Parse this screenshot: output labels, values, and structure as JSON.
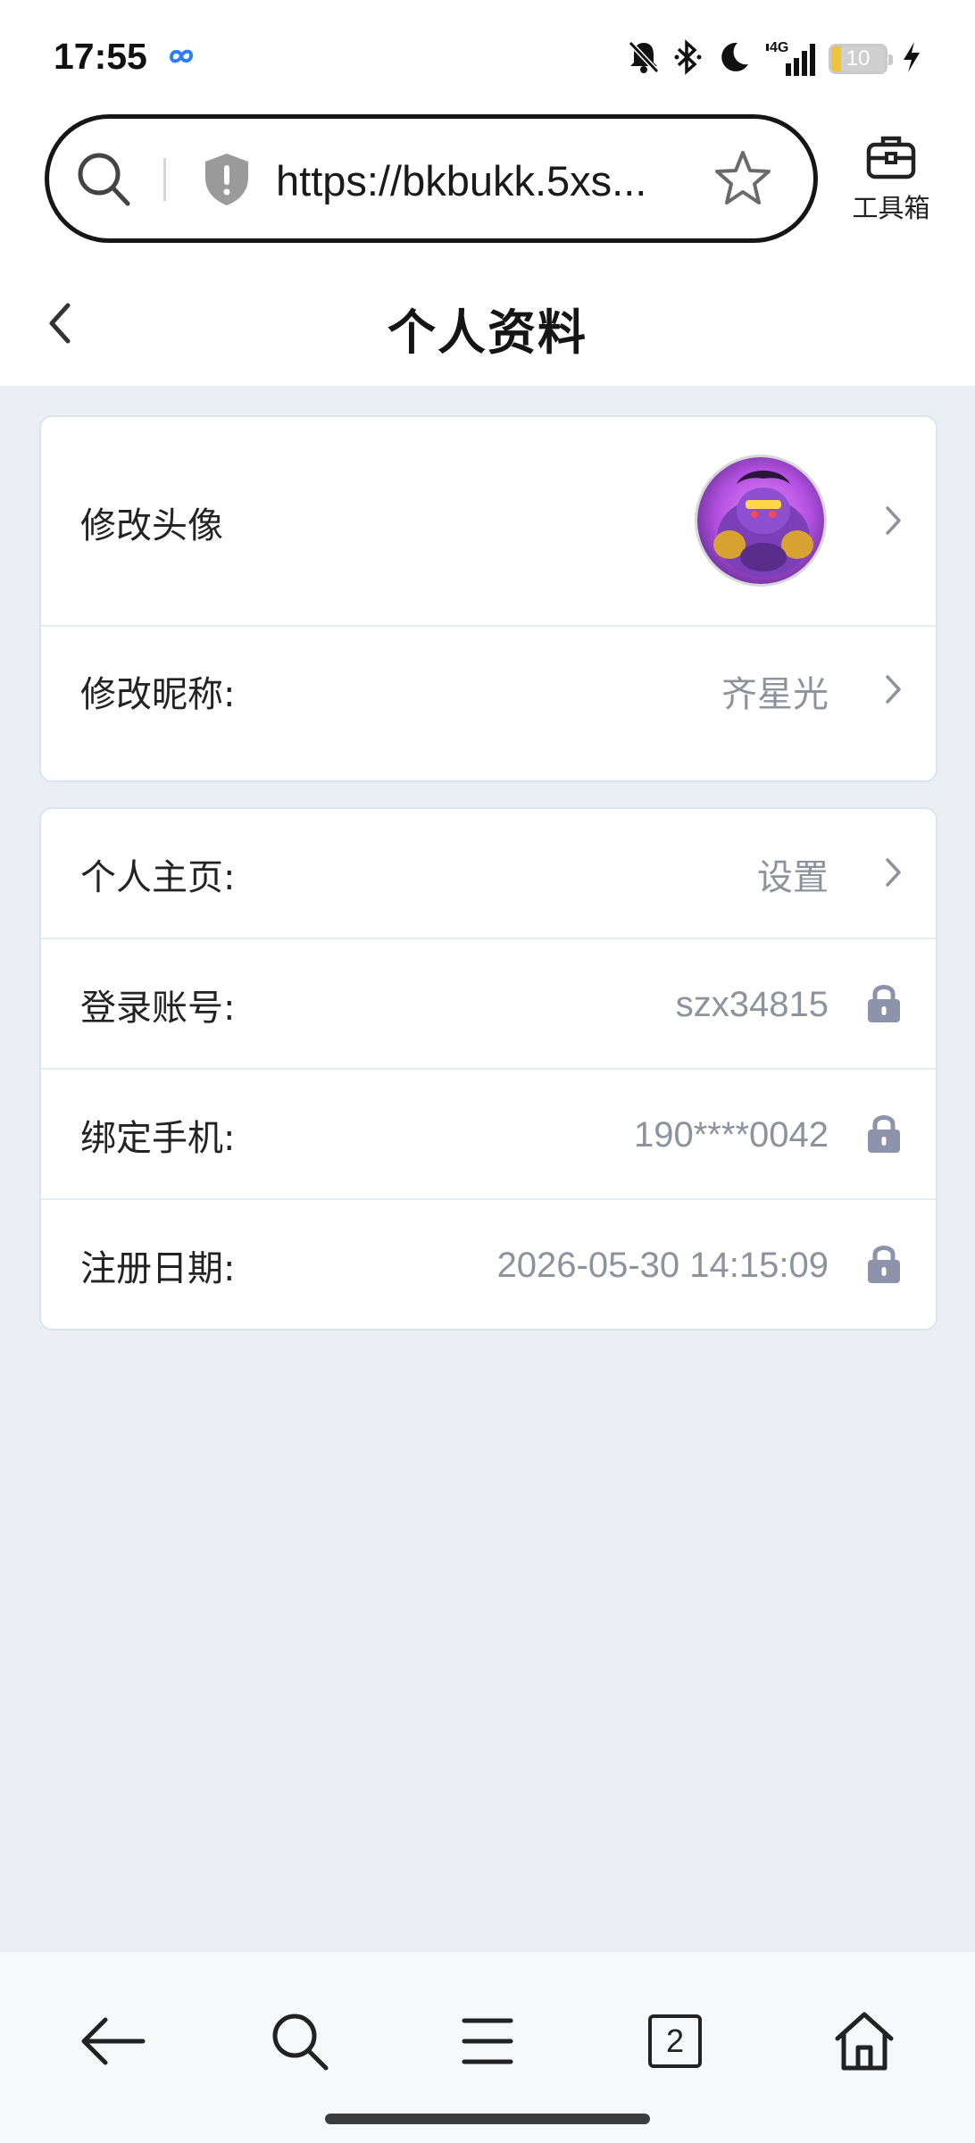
{
  "status_bar": {
    "time": "17:55",
    "battery_level": "10",
    "network": "4G",
    "icons": [
      "cloud-sync-icon",
      "mute-bell-icon",
      "bluetooth-icon",
      "moon-icon",
      "signal-icon",
      "battery-icon",
      "charging-icon"
    ]
  },
  "browser": {
    "url": "https://bkbukk.5xs...",
    "toolbox_label": "工具箱",
    "open_tabs": "2"
  },
  "page": {
    "title": "个人资料"
  },
  "profile": {
    "avatar_label": "修改头像",
    "nickname_label": "修改昵称:",
    "nickname_value": "齐星光",
    "homepage_label": "个人主页:",
    "homepage_value": "设置",
    "account_label": "登录账号:",
    "account_value": "szx34815",
    "phone_label": "绑定手机:",
    "phone_value": "190****0042",
    "register_label": "注册日期:",
    "register_value": "2026-05-30 14:15:09"
  },
  "colors": {
    "page_bg": "#ebeff3",
    "card_border": "#d9e4ee",
    "muted_text": "#8d939c",
    "lock_icon": "#8d93ab",
    "avatar_purple": "#7b3fb8"
  }
}
